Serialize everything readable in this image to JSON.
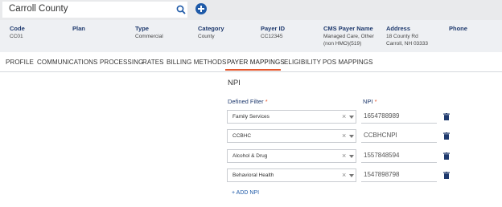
{
  "header": {
    "search_value": "Carroll County"
  },
  "summary": {
    "fields": [
      {
        "label": "Code",
        "value": "CC01"
      },
      {
        "label": "Plan",
        "value": ""
      },
      {
        "label": "Type",
        "value": "Commercial"
      },
      {
        "label": "Category",
        "value": "County"
      },
      {
        "label": "Payer ID",
        "value": "CC12345"
      },
      {
        "label": "CMS Payer Name",
        "value_line1": "Managed Care, Other",
        "value_line2": "(non HMO)(519)"
      },
      {
        "label": "Address",
        "value_line1": "18 County Rd",
        "value_line2": "Carroll, NH 03333"
      },
      {
        "label": "Phone",
        "value": ""
      }
    ]
  },
  "tabs": [
    {
      "label": "PROFILE"
    },
    {
      "label": "COMMUNICATIONS"
    },
    {
      "label": "PROCESSING"
    },
    {
      "label": "RATES"
    },
    {
      "label": "BILLING METHODS"
    },
    {
      "label": "PAYER MAPPINGS",
      "active": true
    },
    {
      "label": "ELIGIBILITY"
    },
    {
      "label": "POS MAPPINGS"
    }
  ],
  "npi_section": {
    "title": "NPI",
    "filter_header": "Defined Filter",
    "npi_header": "NPI",
    "required_mark": "*",
    "rows": [
      {
        "filter": "Family Services",
        "npi": "1654788989"
      },
      {
        "filter": "CCBHC",
        "npi": "CCBHCNPI"
      },
      {
        "filter": "Alcohol & Drug",
        "npi": "1557848594"
      },
      {
        "filter": "Behavioral Health",
        "npi": "1547898798"
      }
    ],
    "add_label": "+ ADD NPI"
  },
  "colors": {
    "accent": "#e4572e",
    "primary": "#1f5aa8",
    "label_navy": "#1f3a6e"
  }
}
